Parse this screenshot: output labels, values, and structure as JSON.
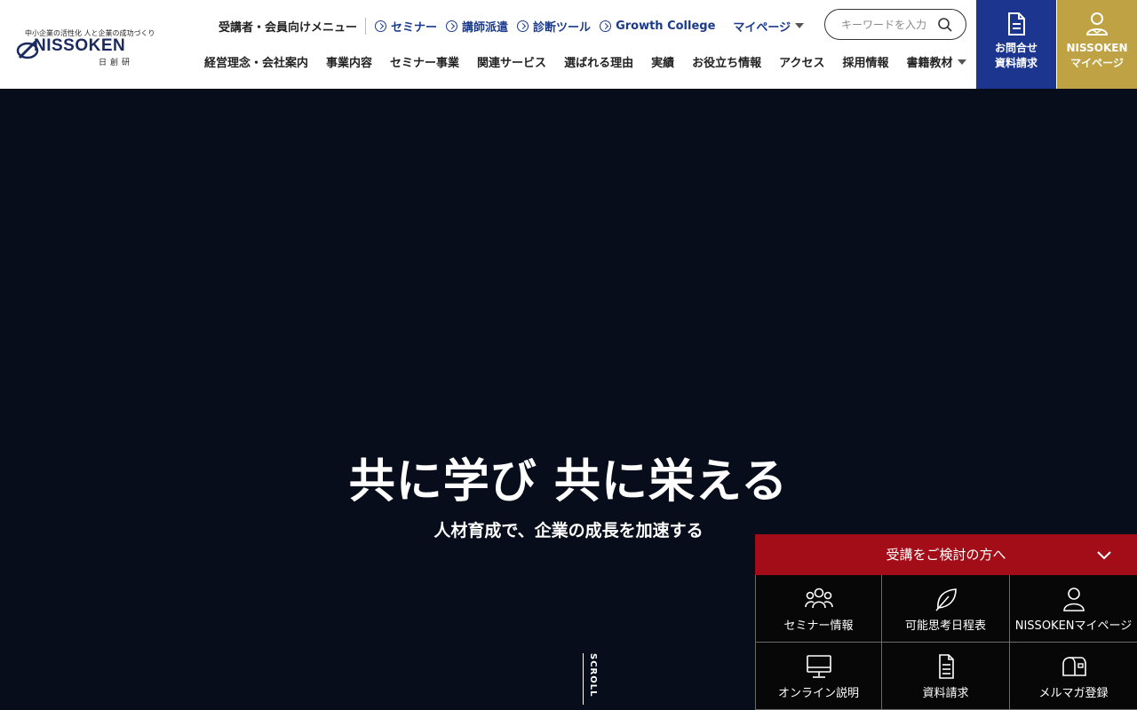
{
  "logo": {
    "tagline": "中小企業の活性化 人と企業の成功づくり",
    "wordmark": "NISSOKEN",
    "kanji": "日創研"
  },
  "top_menu": {
    "title": "受講者・会員向けメニュー",
    "links": [
      "セミナー",
      "講師派遣",
      "診断ツール",
      "Growth College"
    ],
    "mypage": "マイページ"
  },
  "search": {
    "placeholder": "キーワードを入力"
  },
  "main_nav": {
    "items": [
      "経営理念・会社案内",
      "事業内容",
      "セミナー事業",
      "関連サービス",
      "選ばれる理由",
      "実績",
      "お役立ち情報",
      "アクセス",
      "採用情報",
      "書籍教材"
    ]
  },
  "header_buttons": {
    "contact_line1": "お問合せ",
    "contact_line2": "資料請求",
    "mypage_line1": "NISSOKEN",
    "mypage_line2": "マイページ"
  },
  "hero": {
    "title": "共に学び 共に栄える",
    "subtitle": "人材育成で、企業の成長を加速する",
    "scroll": "SCROLL"
  },
  "panel": {
    "header": "受講をご検討の方へ",
    "items": [
      {
        "label": "セミナー情報",
        "icon": "people-icon"
      },
      {
        "label": "可能思考日程表",
        "icon": "leaf-icon"
      },
      {
        "label": "NISSOKENマイページ",
        "icon": "person-icon"
      },
      {
        "label": "オンライン説明",
        "icon": "monitor-icon"
      },
      {
        "label": "資料請求",
        "icon": "document-icon"
      },
      {
        "label": "メルマガ登録",
        "icon": "mailbox-icon"
      }
    ]
  },
  "colors": {
    "brand_navy": "#1c3690",
    "gold": "#bfa243",
    "panel_red": "#a30d18",
    "hero_bg": "#070d1a"
  }
}
